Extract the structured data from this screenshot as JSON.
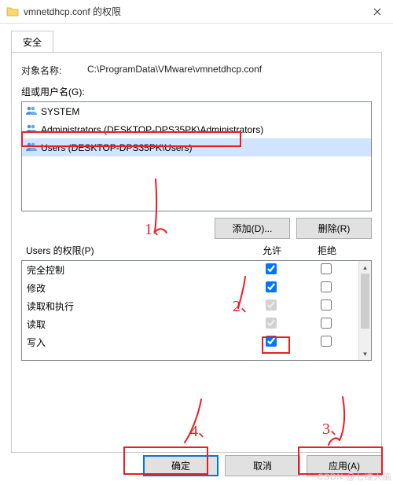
{
  "window": {
    "title": "vmnetdhcp.conf 的权限",
    "close_tooltip": "Close"
  },
  "tabs": {
    "security": "安全"
  },
  "object": {
    "label": "对象名称:",
    "path": "C:\\ProgramData\\VMware\\vmnetdhcp.conf"
  },
  "group_label": "组或用户名(G):",
  "users_list": [
    {
      "icon": "group",
      "name": "SYSTEM"
    },
    {
      "icon": "group",
      "name": "Administrators (DESKTOP-DPS35PK\\Administrators)"
    },
    {
      "icon": "group",
      "name": "Users (DESKTOP-DPS35PK\\Users)",
      "selected": true
    }
  ],
  "buttons": {
    "add": "添加(D)...",
    "remove": "删除(R)",
    "ok": "确定",
    "cancel": "取消",
    "apply": "应用(A)"
  },
  "perm_header": {
    "name": "Users 的权限(P)",
    "allow": "允许",
    "deny": "拒绝"
  },
  "permissions": [
    {
      "name": "完全控制",
      "allow": true,
      "allowDisabled": false,
      "deny": false
    },
    {
      "name": "修改",
      "allow": true,
      "allowDisabled": false,
      "deny": false
    },
    {
      "name": "读取和执行",
      "allow": true,
      "allowDisabled": true,
      "deny": false
    },
    {
      "name": "读取",
      "allow": true,
      "allowDisabled": true,
      "deny": false
    },
    {
      "name": "写入",
      "allow": true,
      "allowDisabled": false,
      "deny": false
    }
  ],
  "annotations": {
    "n1": "1、",
    "n2": "2、",
    "n3": "3、",
    "n4": "4、"
  },
  "watermark": "CSDN @七维大脑"
}
